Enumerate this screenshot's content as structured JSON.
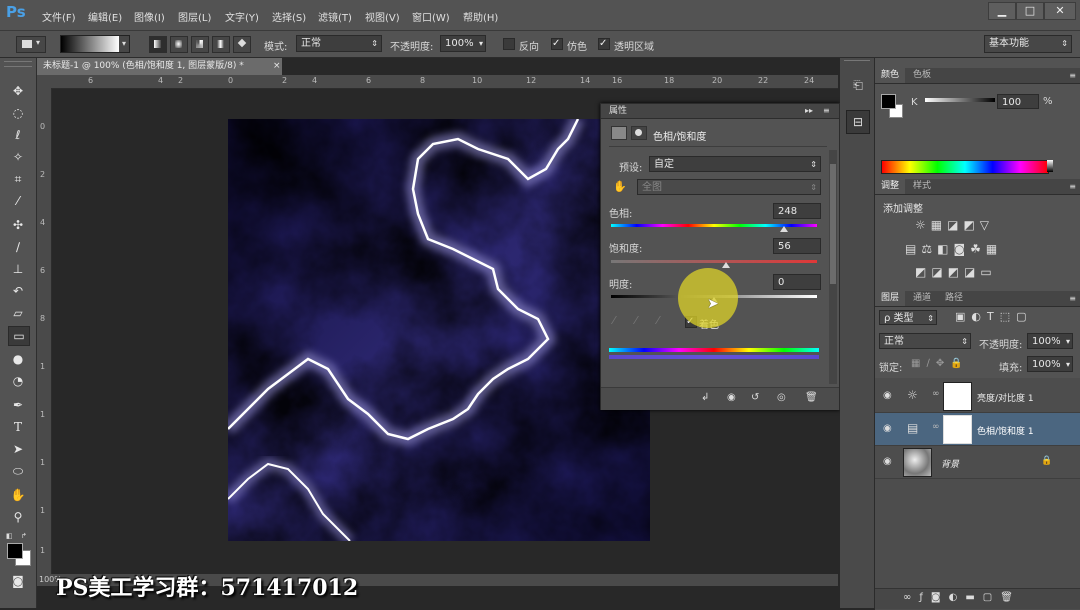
{
  "app": {
    "logo": "Ps",
    "menu": [
      "文件(F)",
      "编辑(E)",
      "图像(I)",
      "图层(L)",
      "文字(Y)",
      "选择(S)",
      "滤镜(T)",
      "视图(V)",
      "窗口(W)",
      "帮助(H)"
    ],
    "window_buttons": [
      "▁",
      "□",
      "✕"
    ]
  },
  "options_bar": {
    "mode_label": "模式:",
    "mode_value": "正常",
    "opacity_label": "不透明度:",
    "opacity_value": "100%",
    "reverse_label": "反向",
    "dither_label": "仿色",
    "transparency_label": "透明区域",
    "workspace": "基本功能"
  },
  "document": {
    "tab_title": "未标题-1 @ 100% (色相/饱和度 1, 图层蒙版/8) *",
    "tab_close": "×",
    "ruler_top": [
      "6",
      "4",
      "2",
      "0",
      "2",
      "4",
      "6",
      "8",
      "10",
      "12",
      "14",
      "16",
      "18",
      "20",
      "22",
      "24"
    ],
    "ruler_left": [
      "0",
      "2",
      "4",
      "6",
      "8",
      "1",
      "1",
      "1",
      "1",
      "1"
    ],
    "status_zoom": "100%"
  },
  "properties": {
    "panel_title": "属性",
    "adjustment_title": "色相/饱和度",
    "preset_label": "预设:",
    "preset_value": "自定",
    "channel_value": "全图",
    "hue_label": "色相:",
    "hue_value": "248",
    "saturation_label": "饱和度:",
    "saturation_value": "56",
    "lightness_label": "明度:",
    "lightness_value": "0",
    "colorize_label": "着色",
    "hue_fraction": 0.84,
    "saturation_fraction": 0.56,
    "lightness_fraction": 0.5
  },
  "color_panel": {
    "tab_color": "颜色",
    "tab_swatches": "色板",
    "channel_label": "K",
    "channel_value": "100",
    "channel_unit": "%"
  },
  "adjustments_panel": {
    "tab_adjust": "调整",
    "tab_styles": "样式",
    "add_label": "添加调整"
  },
  "layers_panel": {
    "tab_layers": "图层",
    "tab_channels": "通道",
    "tab_paths": "路径",
    "filter_label": "ρ 类型",
    "blend_mode": "正常",
    "opacity_label": "不透明度:",
    "opacity_value": "100%",
    "lock_label": "锁定:",
    "fill_label": "填充:",
    "fill_value": "100%",
    "layers": [
      {
        "name": "亮度/对比度 1",
        "selected": false
      },
      {
        "name": "色相/饱和度 1",
        "selected": true
      },
      {
        "name": "背景",
        "selected": false
      }
    ]
  },
  "watermark": "PS美工学习群：571417012",
  "colors": {
    "accent": "#4aa0e6",
    "panel": "#535353",
    "selected_layer": "#4b6680",
    "canvas_dark": "#0f0c36",
    "canvas_light": "#6c66b8"
  }
}
